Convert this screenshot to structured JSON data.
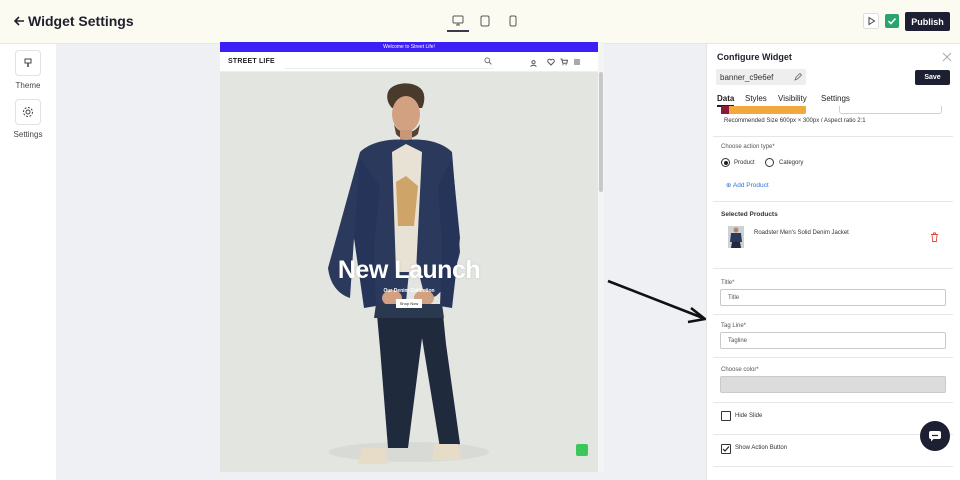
{
  "header": {
    "back_icon": "arrow-left-icon",
    "title": "Widget Settings",
    "devices": [
      "desktop-icon",
      "tablet-icon",
      "mobile-icon"
    ],
    "active_device": "desktop",
    "publish_label": "Publish"
  },
  "sidebar": {
    "items": [
      {
        "label": "Theme",
        "icon": "paint-bucket-icon"
      },
      {
        "label": "Settings",
        "icon": "gear-icon"
      }
    ]
  },
  "preview": {
    "announcement": "Welcome to Street Life!",
    "logo": "STREET LIFE",
    "signin_label": "Sign In",
    "hero": {
      "title": "New Launch",
      "tagline": "Our Denim Collection",
      "button_label": "Shop Now"
    }
  },
  "panel": {
    "title": "Configure Widget",
    "widget_id": "banner_c9e6ef",
    "save_label": "Save",
    "tabs": [
      "Data",
      "Styles",
      "Visibility",
      "Settings"
    ],
    "active_tab": "Data",
    "recommended_hint": "Recommended Size 600px × 300px / Aspect ratio 2:1",
    "action_type_label": "Choose action type*",
    "action_options": [
      "Product",
      "Category"
    ],
    "selected_action": "Product",
    "add_product_label": "Add Product",
    "selected_products_label": "Selected Products",
    "products": [
      {
        "name": "Roadster Men's Solid Denim Jacket"
      }
    ],
    "title_label": "Title*",
    "title_placeholder": "Title",
    "tagline_label": "Tag Line*",
    "tagline_placeholder": "Tagline",
    "color_label": "Choose color*",
    "hide_slide_label": "Hide Slide",
    "hide_slide_checked": false,
    "show_action_label": "Show Action Button",
    "show_action_checked": true
  },
  "colors": {
    "accent_dark": "#1d1f33",
    "announcement_bar": "#3b1ff5",
    "link_blue": "#2e73d9",
    "success_green": "#2aa46f"
  }
}
